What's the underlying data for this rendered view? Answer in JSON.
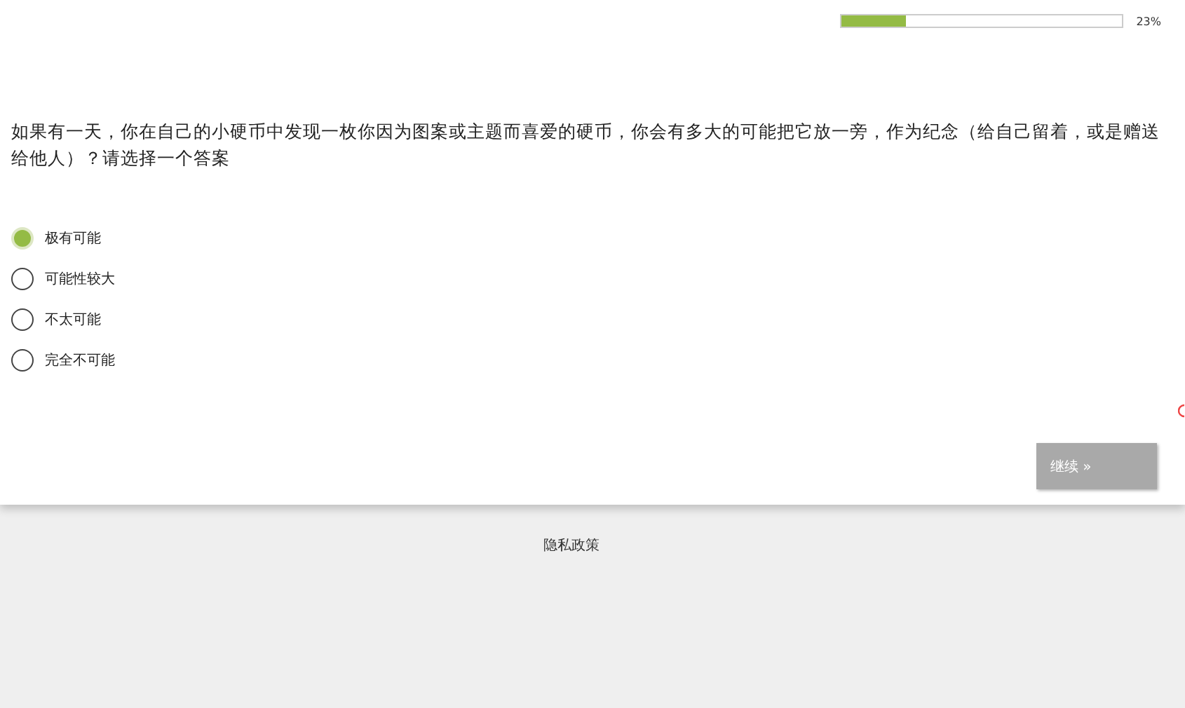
{
  "progress": {
    "level": 0.23,
    "reading": "23%"
  },
  "question": "如果有一天，你在自己的小硬币中发现一枚你因为图案或主题而喜爱的硬币，你会有多大的可能把它放一旁，作为纪念（给自己留着，或是赠送给他人）？请选择一个答案",
  "options": [
    {
      "label": "极有可能",
      "selected": true
    },
    {
      "label": "可能性较大",
      "selected": false
    },
    {
      "label": "不太可能",
      "selected": false
    },
    {
      "label": "完全不可能",
      "selected": false
    }
  ],
  "next_button": "继续 »",
  "footer_link": "隐私政策"
}
